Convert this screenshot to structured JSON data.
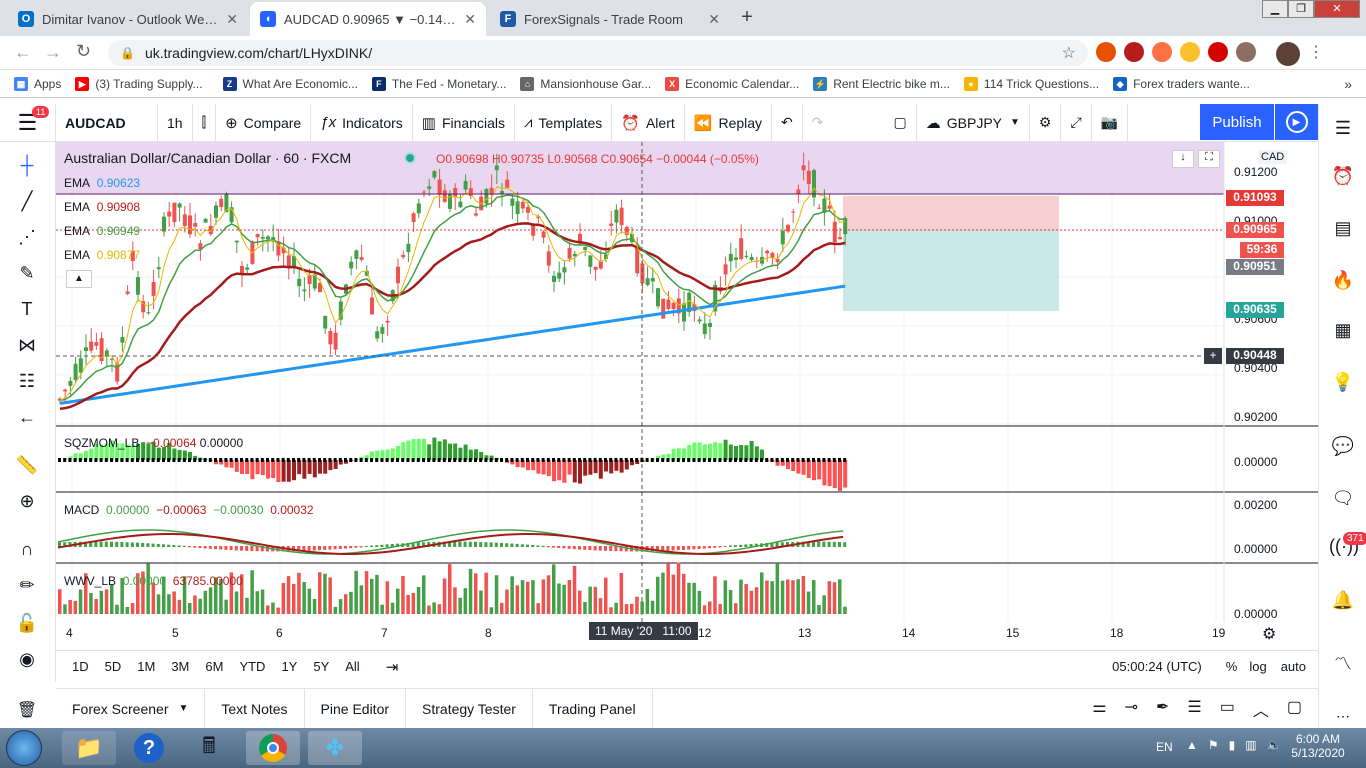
{
  "browser": {
    "tabs": [
      {
        "title": "Dimitar Ivanov - Outlook Web Ap",
        "icon": "outlook-icon"
      },
      {
        "title": "AUDCAD 0.90965 ▼ −0.14% GBP",
        "icon": "tradingview-icon"
      },
      {
        "title": "ForexSignals - Trade Room",
        "icon": "forexsignals-icon"
      }
    ],
    "url": "uk.tradingview.com/chart/LHyxDINK/",
    "bookmarks": [
      {
        "label": "Apps",
        "color": "#4285f4"
      },
      {
        "label": "(3) Trading Supply...",
        "color": "#ff0000"
      },
      {
        "label": "What Are Economic...",
        "color": "#1a3a8a"
      },
      {
        "label": "The Fed - Monetary...",
        "color": "#0b2d6b"
      },
      {
        "label": "Mansionhouse Gar...",
        "color": "#666666"
      },
      {
        "label": "Economic Calendar...",
        "color": "#e74c3c"
      },
      {
        "label": "Rent Electric bike m...",
        "color": "#2d7fb8"
      },
      {
        "label": "114 Trick Questions...",
        "color": "#f5b400"
      },
      {
        "label": "Forex traders wante...",
        "color": "#1565c0"
      }
    ]
  },
  "toolbar": {
    "badge": "11",
    "symbol": "AUDCAD",
    "interval": "1h",
    "compare": "Compare",
    "indicators": "Indicators",
    "financials": "Financials",
    "templates": "Templates",
    "alert": "Alert",
    "replay": "Replay",
    "layout_symbol": "GBPJPY",
    "publish": "Publish"
  },
  "chart": {
    "title": "Australian Dollar/Canadian Dollar · 60 · FXCM",
    "ohlc": "O0.90698 H0.90735 L0.90568 C0.90654 −0.00044 (−0.05%)",
    "currency": "CAD",
    "emas": [
      {
        "label": "EMA",
        "value": "0.90623",
        "color": "#2196f3"
      },
      {
        "label": "EMA",
        "value": "0.90908",
        "color": "#b71c1c"
      },
      {
        "label": "EMA",
        "value": "0.90949",
        "color": "#43a047"
      },
      {
        "label": "EMA",
        "value": "0.90877",
        "color": "#e6b800"
      }
    ],
    "price_axis": [
      "0.91200",
      "0.91000",
      "0.90800",
      "0.90600",
      "0.90400",
      "0.90200"
    ],
    "price_tags": [
      {
        "value": "0.91093",
        "color": "#e53935"
      },
      {
        "value": "0.90965",
        "color": "#ef5350"
      },
      {
        "value": "59:36",
        "color": "#ef5350"
      },
      {
        "value": "0.90951",
        "color": "#787b86"
      },
      {
        "value": "0.90635",
        "color": "#26a69a"
      },
      {
        "value": "0.90448",
        "color": "#363a45"
      }
    ],
    "time_axis": [
      "4",
      "5",
      "6",
      "7",
      "8",
      "11 May '20   11:00",
      "12",
      "13",
      "14",
      "15",
      "18",
      "19"
    ],
    "sqz": {
      "name": "SQZMOM_LB",
      "v1": "−0.00064",
      "v2": "0.00000",
      "axis": "0.00000"
    },
    "macd": {
      "name": "MACD",
      "v1": "0.00000",
      "v2": "−0.00063",
      "v3": "−0.00030",
      "v4": "0.00032",
      "axis_top": "0.00200",
      "axis_mid": "0.00000"
    },
    "wwv": {
      "name": "WWV_LB",
      "v1": "0.00000",
      "v2": "63785.00000",
      "axis": "0.00000"
    }
  },
  "range": {
    "buttons": [
      "1D",
      "5D",
      "1M",
      "3M",
      "6M",
      "YTD",
      "1Y",
      "5Y",
      "All"
    ],
    "clock": "05:00:24 (UTC)",
    "pct": "%",
    "log": "log",
    "auto": "auto"
  },
  "panels": [
    "Forex Screener",
    "Text Notes",
    "Pine Editor",
    "Strategy Tester",
    "Trading Panel"
  ],
  "right_badge": "371",
  "taskbar": {
    "lang": "EN",
    "time": "6:00 AM",
    "date": "5/13/2020"
  }
}
